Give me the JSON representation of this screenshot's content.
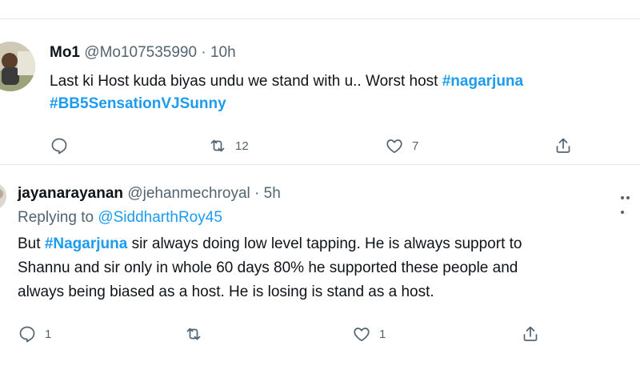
{
  "tweets": [
    {
      "name": "Mo1",
      "handle": "@Mo107535990",
      "separator": "·",
      "time": "10h",
      "text_part1": "Last ki Host kuda biyas undu we stand with u.. Worst host ",
      "hashtag1": "#nagarjuna",
      "hashtag2": "#BB5SensationVJSunny",
      "actions": {
        "reply_count": "",
        "retweet_count": "12",
        "like_count": "7"
      }
    },
    {
      "name": "jayanarayanan",
      "handle": "@jehanmechroyal",
      "separator": "·",
      "time": "5h",
      "replying_label": "Replying to ",
      "replying_to": "@SiddharthRoy45",
      "text_prefix": "But ",
      "hashtag": "#Nagarjuna",
      "text_line1": " sir always doing low level tapping. He is always support to",
      "text_line2": "Shannu and sir only in whole 60 days 80% he supported these people and",
      "text_line3": "always being biased as a host. He is losing is stand as a host.",
      "actions": {
        "reply_count": "1",
        "retweet_count": "",
        "like_count": "1"
      }
    }
  ],
  "icons": [
    "reply-icon",
    "retweet-icon",
    "like-icon",
    "share-icon",
    "more-icon"
  ],
  "colors": {
    "link": "#1d9bf0",
    "text": "#0f1419",
    "muted": "#536471",
    "divider": "#e4e8eb"
  }
}
